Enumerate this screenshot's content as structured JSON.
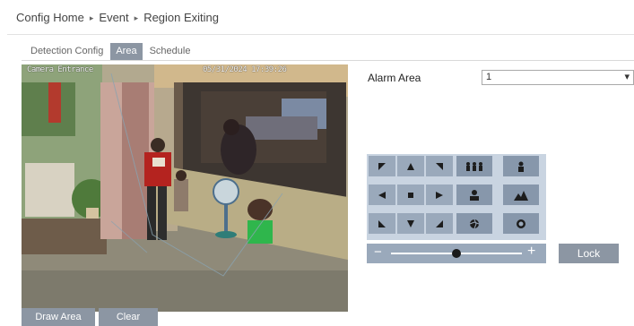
{
  "breadcrumb": {
    "home": "Config Home",
    "level1": "Event",
    "level2": "Region Exiting",
    "separator": "▸"
  },
  "tabs": {
    "detection": "Detection Config",
    "area": "Area",
    "schedule": "Schedule"
  },
  "video": {
    "osd_channel": "Camera Entrance",
    "osd_datetime": "05/31/2024 17:39:26"
  },
  "buttons": {
    "draw_area": "Draw Area",
    "clear": "Clear",
    "lock": "Lock"
  },
  "alarm": {
    "label": "Alarm Area",
    "selected": "1",
    "arrow": "▾"
  },
  "ptz": {
    "icons": [
      "up-left-arrow-icon",
      "up-arrow-icon",
      "up-right-arrow-icon",
      "zoom-out-people-icon",
      "zoom-in-person-icon",
      "left-arrow-icon",
      "stop-icon",
      "right-arrow-icon",
      "focus-near-icon",
      "focus-far-icon",
      "down-left-arrow-icon",
      "down-arrow-icon",
      "down-right-arrow-icon",
      "iris-close-icon",
      "iris-open-icon"
    ],
    "slider_level": 0.5,
    "minus": "−",
    "plus": "+"
  }
}
